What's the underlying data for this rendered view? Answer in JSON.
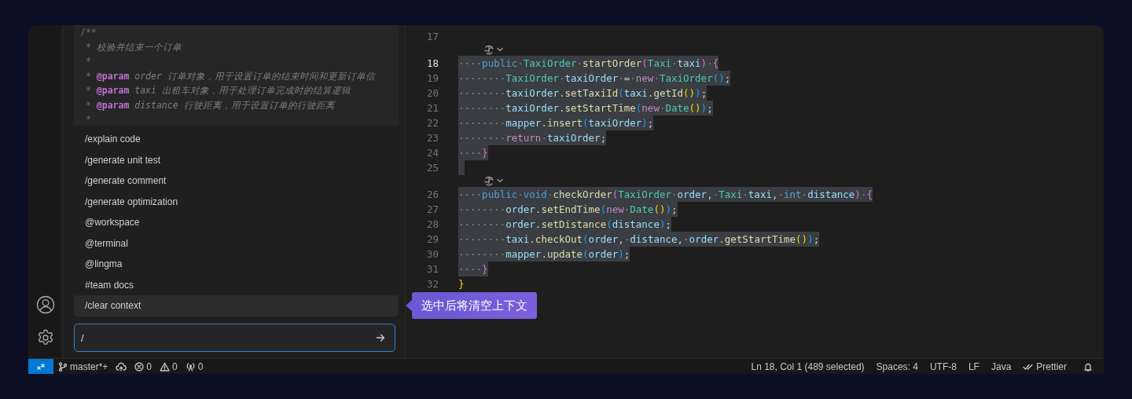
{
  "chat": {
    "comment_lines": [
      [
        {
          "kind": "star",
          "text": "/**"
        }
      ],
      [
        {
          "kind": "star",
          "text": " *"
        },
        {
          "kind": "text",
          "text": " 校验并结束一个订单"
        }
      ],
      [
        {
          "kind": "star",
          "text": " *"
        }
      ],
      [
        {
          "kind": "star",
          "text": " * "
        },
        {
          "kind": "tag",
          "text": "@param"
        },
        {
          "kind": "text",
          "text": " order 订单对象，用于设置订单的结束时间和更新订单信"
        }
      ],
      [
        {
          "kind": "star",
          "text": " * "
        },
        {
          "kind": "tag",
          "text": "@param"
        },
        {
          "kind": "text",
          "text": " taxi 出租车对象，用于处理订单完成时的结算逻辑"
        }
      ],
      [
        {
          "kind": "star",
          "text": " * "
        },
        {
          "kind": "tag",
          "text": "@param"
        },
        {
          "kind": "text",
          "text": " distance 行驶距离，用于设置订单的行驶距离"
        }
      ],
      [
        {
          "kind": "star",
          "text": " *"
        }
      ]
    ],
    "commands": [
      {
        "label": "/explain code",
        "selected": false
      },
      {
        "label": "/generate unit test",
        "selected": false
      },
      {
        "label": "/generate comment",
        "selected": false
      },
      {
        "label": "/generate optimization",
        "selected": false
      },
      {
        "label": "@workspace",
        "selected": false
      },
      {
        "label": "@terminal",
        "selected": false
      },
      {
        "label": "@lingma",
        "selected": false
      },
      {
        "label": "#team docs",
        "selected": false
      },
      {
        "label": "/clear context",
        "selected": true
      }
    ],
    "input": {
      "value": "/"
    },
    "tooltip": {
      "text": "选中后将清空上下文"
    }
  },
  "editor": {
    "lines": [
      {
        "kind": "code",
        "number": "17",
        "selected": false,
        "current": false
      },
      {
        "kind": "codelens"
      },
      {
        "kind": "code",
        "number": "18",
        "selected": true,
        "current": true,
        "tokens": [
          {
            "kind": "ws",
            "text": "····"
          },
          {
            "kind": "kw",
            "text": "public"
          },
          {
            "kind": "ws",
            "text": "·"
          },
          {
            "kind": "type",
            "text": "TaxiOrder"
          },
          {
            "kind": "ws",
            "text": "·"
          },
          {
            "kind": "fn",
            "text": "startOrder"
          },
          {
            "kind": "b2",
            "text": "("
          },
          {
            "kind": "type",
            "text": "Taxi"
          },
          {
            "kind": "ws",
            "text": "·"
          },
          {
            "kind": "var",
            "text": "taxi"
          },
          {
            "kind": "b2",
            "text": ")"
          },
          {
            "kind": "ws",
            "text": "·"
          },
          {
            "kind": "b2",
            "text": "{"
          }
        ]
      },
      {
        "kind": "code",
        "number": "19",
        "selected": true,
        "current": false,
        "tokens": [
          {
            "kind": "ws",
            "text": "········"
          },
          {
            "kind": "type",
            "text": "TaxiOrder"
          },
          {
            "kind": "ws",
            "text": "·"
          },
          {
            "kind": "var",
            "text": "taxiOrder"
          },
          {
            "kind": "ws",
            "text": "·"
          },
          {
            "kind": "p",
            "text": "="
          },
          {
            "kind": "ws",
            "text": "·"
          },
          {
            "kind": "kw2",
            "text": "new"
          },
          {
            "kind": "ws",
            "text": "·"
          },
          {
            "kind": "type",
            "text": "TaxiOrder"
          },
          {
            "kind": "b3",
            "text": "()"
          },
          {
            "kind": "p",
            "text": ";"
          }
        ]
      },
      {
        "kind": "code",
        "number": "20",
        "selected": true,
        "current": false,
        "tokens": [
          {
            "kind": "ws",
            "text": "········"
          },
          {
            "kind": "var",
            "text": "taxiOrder"
          },
          {
            "kind": "p",
            "text": "."
          },
          {
            "kind": "fn",
            "text": "setTaxiId"
          },
          {
            "kind": "b3",
            "text": "("
          },
          {
            "kind": "var",
            "text": "taxi"
          },
          {
            "kind": "p",
            "text": "."
          },
          {
            "kind": "fn",
            "text": "getId"
          },
          {
            "kind": "b1",
            "text": "()"
          },
          {
            "kind": "b3",
            "text": ")"
          },
          {
            "kind": "p",
            "text": ";"
          }
        ]
      },
      {
        "kind": "code",
        "number": "21",
        "selected": true,
        "current": false,
        "tokens": [
          {
            "kind": "ws",
            "text": "········"
          },
          {
            "kind": "var",
            "text": "taxiOrder"
          },
          {
            "kind": "p",
            "text": "."
          },
          {
            "kind": "fn",
            "text": "setStartTime"
          },
          {
            "kind": "b3",
            "text": "("
          },
          {
            "kind": "kw2",
            "text": "new"
          },
          {
            "kind": "ws",
            "text": "·"
          },
          {
            "kind": "type",
            "text": "Date"
          },
          {
            "kind": "b1",
            "text": "()"
          },
          {
            "kind": "b3",
            "text": ")"
          },
          {
            "kind": "p",
            "text": ";"
          }
        ]
      },
      {
        "kind": "code",
        "number": "22",
        "selected": true,
        "current": false,
        "tokens": [
          {
            "kind": "ws",
            "text": "········"
          },
          {
            "kind": "var",
            "text": "mapper"
          },
          {
            "kind": "p",
            "text": "."
          },
          {
            "kind": "fn",
            "text": "insert"
          },
          {
            "kind": "b3",
            "text": "("
          },
          {
            "kind": "var",
            "text": "taxiOrder"
          },
          {
            "kind": "b3",
            "text": ")"
          },
          {
            "kind": "p",
            "text": ";"
          }
        ]
      },
      {
        "kind": "code",
        "number": "23",
        "selected": true,
        "current": false,
        "tokens": [
          {
            "kind": "ws",
            "text": "········"
          },
          {
            "kind": "kw2",
            "text": "return"
          },
          {
            "kind": "ws",
            "text": "·"
          },
          {
            "kind": "var",
            "text": "taxiOrder"
          },
          {
            "kind": "p",
            "text": ";"
          }
        ]
      },
      {
        "kind": "code",
        "number": "24",
        "selected": true,
        "current": false,
        "tokens": [
          {
            "kind": "ws",
            "text": "····"
          },
          {
            "kind": "b2",
            "text": "}"
          }
        ]
      },
      {
        "kind": "code",
        "number": "25",
        "selected": true,
        "current": false
      },
      {
        "kind": "codelens"
      },
      {
        "kind": "code",
        "number": "26",
        "selected": true,
        "current": false,
        "tokens": [
          {
            "kind": "ws",
            "text": "····"
          },
          {
            "kind": "kw",
            "text": "public"
          },
          {
            "kind": "ws",
            "text": "·"
          },
          {
            "kind": "kw",
            "text": "void"
          },
          {
            "kind": "ws",
            "text": "·"
          },
          {
            "kind": "fn",
            "text": "checkOrder"
          },
          {
            "kind": "b2",
            "text": "("
          },
          {
            "kind": "type",
            "text": "TaxiOrder"
          },
          {
            "kind": "ws",
            "text": "·"
          },
          {
            "kind": "var",
            "text": "order"
          },
          {
            "kind": "p",
            "text": ","
          },
          {
            "kind": "ws",
            "text": "·"
          },
          {
            "kind": "type",
            "text": "Taxi"
          },
          {
            "kind": "ws",
            "text": "·"
          },
          {
            "kind": "var",
            "text": "taxi"
          },
          {
            "kind": "p",
            "text": ","
          },
          {
            "kind": "ws",
            "text": "·"
          },
          {
            "kind": "kw",
            "text": "int"
          },
          {
            "kind": "ws",
            "text": "·"
          },
          {
            "kind": "var",
            "text": "distance"
          },
          {
            "kind": "b2",
            "text": ")"
          },
          {
            "kind": "ws",
            "text": "·"
          },
          {
            "kind": "b2",
            "text": "{"
          }
        ]
      },
      {
        "kind": "code",
        "number": "27",
        "selected": true,
        "current": false,
        "tokens": [
          {
            "kind": "ws",
            "text": "········"
          },
          {
            "kind": "var",
            "text": "order"
          },
          {
            "kind": "p",
            "text": "."
          },
          {
            "kind": "fn",
            "text": "setEndTime"
          },
          {
            "kind": "b3",
            "text": "("
          },
          {
            "kind": "kw2",
            "text": "new"
          },
          {
            "kind": "ws",
            "text": "·"
          },
          {
            "kind": "type",
            "text": "Date"
          },
          {
            "kind": "b1",
            "text": "()"
          },
          {
            "kind": "b3",
            "text": ")"
          },
          {
            "kind": "p",
            "text": ";"
          }
        ]
      },
      {
        "kind": "code",
        "number": "28",
        "selected": true,
        "current": false,
        "tokens": [
          {
            "kind": "ws",
            "text": "········"
          },
          {
            "kind": "var",
            "text": "order"
          },
          {
            "kind": "p",
            "text": "."
          },
          {
            "kind": "fn",
            "text": "setDistance"
          },
          {
            "kind": "b3",
            "text": "("
          },
          {
            "kind": "var",
            "text": "distance"
          },
          {
            "kind": "b3",
            "text": ")"
          },
          {
            "kind": "p",
            "text": ";"
          }
        ]
      },
      {
        "kind": "code",
        "number": "29",
        "selected": true,
        "current": false,
        "tokens": [
          {
            "kind": "ws",
            "text": "········"
          },
          {
            "kind": "var",
            "text": "taxi"
          },
          {
            "kind": "p",
            "text": "."
          },
          {
            "kind": "fn",
            "text": "checkOut"
          },
          {
            "kind": "b3",
            "text": "("
          },
          {
            "kind": "var",
            "text": "order"
          },
          {
            "kind": "p",
            "text": ","
          },
          {
            "kind": "ws",
            "text": "·"
          },
          {
            "kind": "var",
            "text": "distance"
          },
          {
            "kind": "p",
            "text": ","
          },
          {
            "kind": "ws",
            "text": "·"
          },
          {
            "kind": "var",
            "text": "order"
          },
          {
            "kind": "p",
            "text": "."
          },
          {
            "kind": "fn",
            "text": "getStartTime"
          },
          {
            "kind": "b1",
            "text": "()"
          },
          {
            "kind": "b3",
            "text": ")"
          },
          {
            "kind": "p",
            "text": ";"
          }
        ]
      },
      {
        "kind": "code",
        "number": "30",
        "selected": true,
        "current": false,
        "tokens": [
          {
            "kind": "ws",
            "text": "········"
          },
          {
            "kind": "var",
            "text": "mapper"
          },
          {
            "kind": "p",
            "text": "."
          },
          {
            "kind": "fn",
            "text": "update"
          },
          {
            "kind": "b3",
            "text": "("
          },
          {
            "kind": "var",
            "text": "order"
          },
          {
            "kind": "b3",
            "text": ")"
          },
          {
            "kind": "p",
            "text": ";"
          }
        ]
      },
      {
        "kind": "code",
        "number": "31",
        "selected": true,
        "current": false,
        "tokens": [
          {
            "kind": "ws",
            "text": "····"
          },
          {
            "kind": "b2",
            "text": "}"
          }
        ]
      },
      {
        "kind": "code",
        "number": "32",
        "selected": false,
        "current": false,
        "tokens": [
          {
            "kind": "b1",
            "text": "}"
          }
        ]
      }
    ]
  },
  "status_bar": {
    "left": [
      {
        "kind": "branch",
        "text": "master*+"
      },
      {
        "kind": "sync"
      },
      {
        "kind": "errors",
        "text": "0"
      },
      {
        "kind": "warnings",
        "text": "0"
      },
      {
        "kind": "ports",
        "text": "0"
      }
    ],
    "right": [
      {
        "kind": "text",
        "text": "Ln 18, Col 1 (489 selected)"
      },
      {
        "kind": "text",
        "text": "Spaces: 4"
      },
      {
        "kind": "text",
        "text": "UTF-8"
      },
      {
        "kind": "text",
        "text": "LF"
      },
      {
        "kind": "text",
        "text": "Java"
      },
      {
        "kind": "prettier",
        "text": "Prettier"
      },
      {
        "kind": "bell"
      }
    ]
  }
}
